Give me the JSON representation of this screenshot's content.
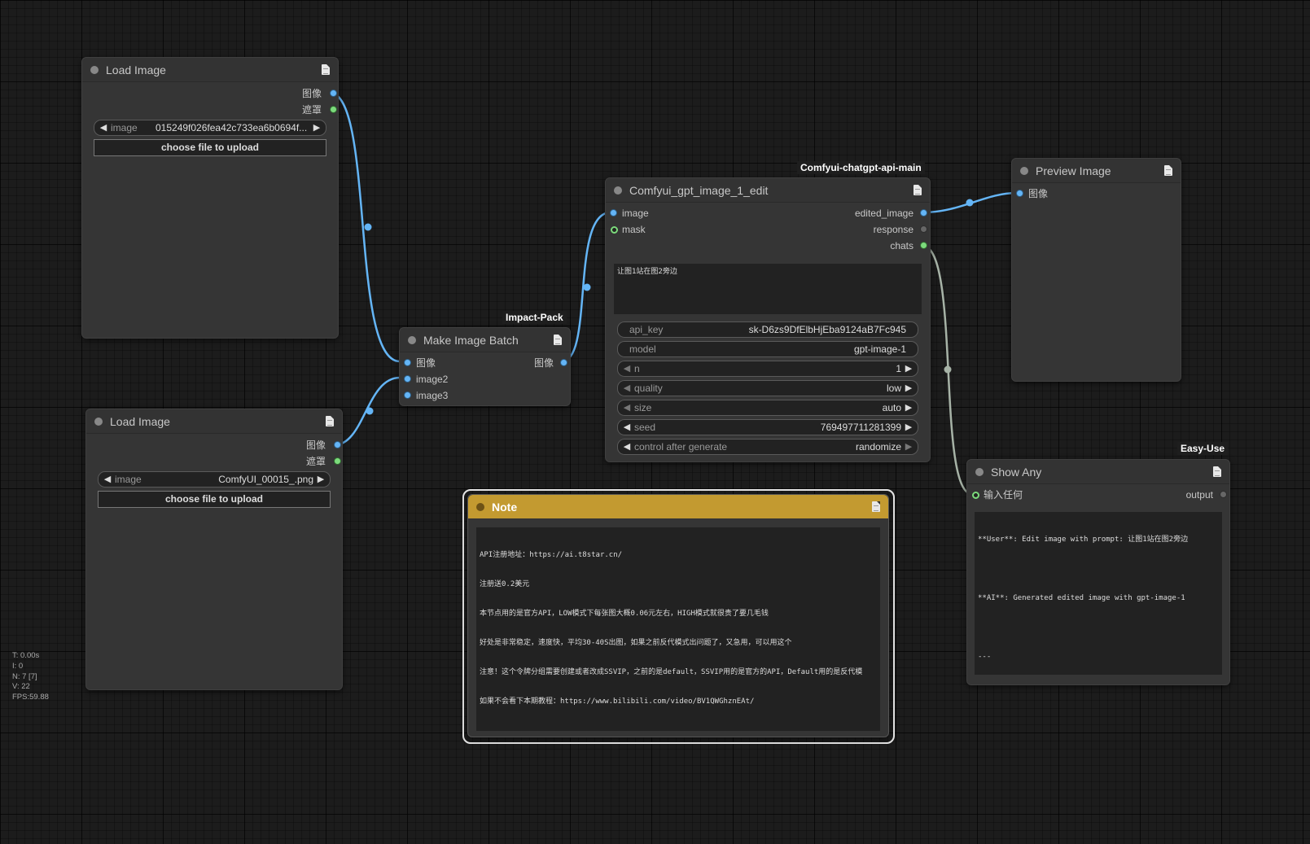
{
  "nodes": {
    "load_image_1": {
      "title": "Load Image",
      "outputs": [
        "图像",
        "遮罩"
      ],
      "image_widget": {
        "label": "image",
        "value": "015249f026fea42c733ea6b0694f..."
      },
      "upload_label": "choose file to upload"
    },
    "load_image_2": {
      "title": "Load Image",
      "outputs": [
        "图像",
        "遮罩"
      ],
      "image_widget": {
        "label": "image",
        "value": "ComfyUI_00015_.png"
      },
      "upload_label": "choose file to upload"
    },
    "make_image_batch": {
      "pack": "Impact-Pack",
      "title": "Make Image Batch",
      "inputs": [
        "图像",
        "image2",
        "image3"
      ],
      "outputs": [
        "图像"
      ]
    },
    "gpt_edit": {
      "pack": "Comfyui-chatgpt-api-main",
      "title": "Comfyui_gpt_image_1_edit",
      "inputs": [
        "image",
        "mask"
      ],
      "outputs": [
        "edited_image",
        "response",
        "chats"
      ],
      "prompt": "让图1站在图2旁边",
      "widgets": [
        {
          "label": "api_key",
          "value": "sk-D6zs9DfElbHjEba9124aB7Fc945"
        },
        {
          "label": "model",
          "value": "gpt-image-1"
        },
        {
          "label": "n",
          "value": "1"
        },
        {
          "label": "quality",
          "value": "low"
        },
        {
          "label": "size",
          "value": "auto"
        },
        {
          "label": "seed",
          "value": "769497711281399"
        },
        {
          "label": "control after generate",
          "value": "randomize"
        }
      ]
    },
    "preview_image": {
      "title": "Preview Image",
      "inputs": [
        "图像"
      ]
    },
    "show_any": {
      "pack": "Easy-Use",
      "title": "Show Any",
      "inputs": [
        "输入任何"
      ],
      "outputs": [
        "output"
      ],
      "text_lines": [
        "**User**: Edit image with prompt: 让图1站在图2旁边",
        "",
        "**AI**: Generated edited image with gpt-image-1",
        "",
        "---"
      ]
    },
    "note": {
      "title": "Note",
      "text_lines": [
        "API注册地址：https://ai.t8star.cn/",
        "注册送0.2美元",
        "本节点用的是官方API，LOW模式下每张图大概0.06元左右，HIGH模式就很贵了要几毛钱",
        "好处是非常稳定，速度快，平均30-40S出图，如果之前反代模式出问题了，又急用，可以用这个",
        "注意！这个令牌分组需要创建或者改成SSVIP，之前的是default，SSVIP用的是官方的API，Default用的是反代模",
        "如果不会看下本期教程：https://www.bilibili.com/video/BV1QWGhznEAt/"
      ]
    }
  },
  "stats": [
    "T: 0.00s",
    "I: 0",
    "N: 7 [7]",
    "V: 22",
    "FPS:59.88"
  ],
  "colors": {
    "canvas": "#1c1c1c",
    "node_bg": "#353535",
    "image_link": "#64b5f6",
    "mask_link": "#7cdb7c",
    "any_link": "#a7b3a7",
    "note_title": "#c39a30"
  }
}
